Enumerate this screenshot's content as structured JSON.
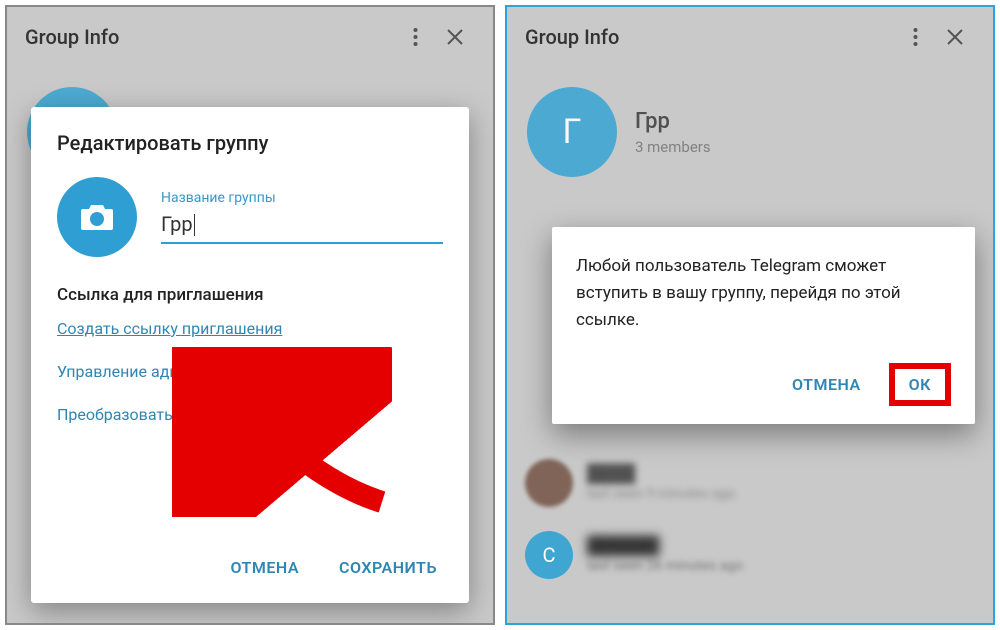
{
  "left": {
    "header": {
      "title": "Group Info"
    },
    "modal": {
      "title": "Редактировать группу",
      "field_label": "Название группы",
      "group_name": "Грр",
      "invite_section": "Ссылка для приглашения",
      "create_link": "Создать ссылку приглашения",
      "manage_admins": "Управление администраторами",
      "convert": "Преобразовать в супергруппу",
      "cancel": "ОТМЕНА",
      "save": "СОХРАНИТЬ"
    }
  },
  "right": {
    "header": {
      "title": "Group Info"
    },
    "group": {
      "avatar_letter": "Г",
      "name": "Грр",
      "subtitle": "3 members"
    },
    "confirm": {
      "text": "Любой пользователь Telegram сможет вступить в вашу группу, перейдя по этой ссылке.",
      "cancel": "ОТМЕНА",
      "ok": "ОК"
    },
    "members": [
      {
        "sub": "last seen 9 minutes ago"
      },
      {
        "avatar_letter": "С",
        "sub": "last seen 26 minutes ago"
      }
    ]
  }
}
